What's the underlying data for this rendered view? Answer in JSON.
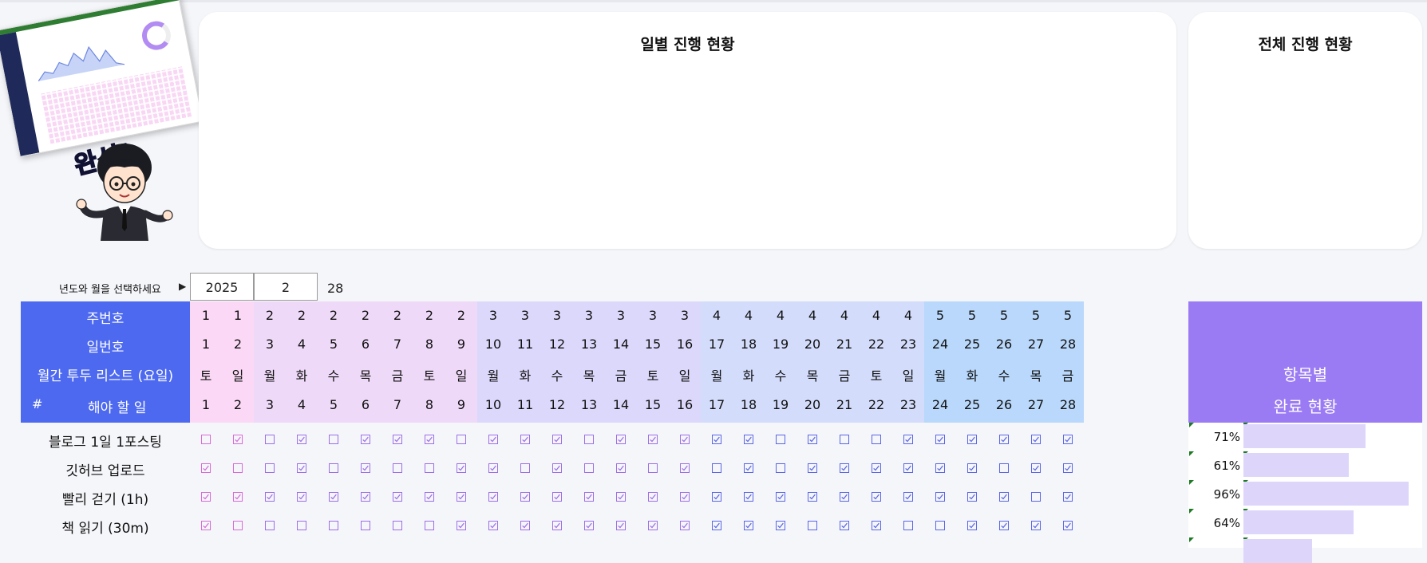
{
  "panels": {
    "daily_title": "일별 진행 현황",
    "overall_title": "전체 진행 현황"
  },
  "selector": {
    "label": "년도와 월을 선택하세요",
    "year": "2025",
    "month": "2",
    "days": "28"
  },
  "header_labels": {
    "week": "주번호",
    "day": "일번호",
    "weekday": "월간 투두 리스트 (요일)",
    "hash": "#",
    "todo": "해야 할 일"
  },
  "days": {
    "week": [
      1,
      1,
      2,
      2,
      2,
      2,
      2,
      2,
      2,
      3,
      3,
      3,
      3,
      3,
      3,
      3,
      4,
      4,
      4,
      4,
      4,
      4,
      4,
      5,
      5,
      5,
      5,
      5
    ],
    "day": [
      1,
      2,
      3,
      4,
      5,
      6,
      7,
      8,
      9,
      10,
      11,
      12,
      13,
      14,
      15,
      16,
      17,
      18,
      19,
      20,
      21,
      22,
      23,
      24,
      25,
      26,
      27,
      28
    ],
    "weekday": [
      "토",
      "일",
      "월",
      "화",
      "수",
      "목",
      "금",
      "토",
      "일",
      "월",
      "화",
      "수",
      "목",
      "금",
      "토",
      "일",
      "월",
      "화",
      "수",
      "목",
      "금",
      "토",
      "일",
      "월",
      "화",
      "수",
      "목",
      "금"
    ],
    "num": [
      1,
      2,
      3,
      4,
      5,
      6,
      7,
      8,
      9,
      10,
      11,
      12,
      13,
      14,
      15,
      16,
      17,
      18,
      19,
      20,
      21,
      22,
      23,
      24,
      25,
      26,
      27,
      28
    ]
  },
  "summary": {
    "line1": "항목별",
    "line2": "완료 현황"
  },
  "tasks": [
    {
      "name": "블로그 1일 1포스팅",
      "pct": "71%",
      "ratio": 0.71,
      "checks": [
        0,
        1,
        0,
        1,
        0,
        1,
        1,
        1,
        0,
        1,
        1,
        1,
        0,
        1,
        1,
        1,
        1,
        1,
        0,
        1,
        0,
        0,
        1,
        1,
        1,
        1,
        1,
        1
      ]
    },
    {
      "name": "깃허브 업로드",
      "pct": "61%",
      "ratio": 0.61,
      "checks": [
        1,
        0,
        0,
        1,
        0,
        1,
        0,
        0,
        1,
        1,
        0,
        1,
        0,
        1,
        0,
        1,
        0,
        1,
        0,
        1,
        1,
        1,
        1,
        1,
        1,
        0,
        1,
        1
      ]
    },
    {
      "name": "빨리 걷기 (1h)",
      "pct": "96%",
      "ratio": 0.96,
      "checks": [
        1,
        1,
        1,
        1,
        1,
        1,
        1,
        1,
        1,
        1,
        1,
        1,
        1,
        1,
        1,
        1,
        1,
        1,
        1,
        1,
        1,
        1,
        1,
        1,
        1,
        1,
        0,
        1
      ]
    },
    {
      "name": "책 읽기 (30m)",
      "pct": "64%",
      "ratio": 0.64,
      "checks": [
        1,
        0,
        0,
        0,
        0,
        0,
        0,
        0,
        1,
        1,
        1,
        1,
        1,
        1,
        1,
        1,
        1,
        1,
        1,
        0,
        1,
        1,
        0,
        0,
        1,
        1,
        1,
        1
      ]
    },
    {
      "name": "",
      "pct": "",
      "ratio": 0.4,
      "checks": []
    }
  ],
  "colors": {
    "header_blue": "#4d69f0",
    "summary_purple": "#9a7bf4",
    "band_week1": "#fbd9f6",
    "band_week2": "#efd9f8",
    "band_week3": "#dcd8fb",
    "band_week4": "#d3dcfb",
    "band_week5": "#b9d8fb",
    "check_pink": "#d86ad8",
    "check_violet": "#9d6ee8",
    "check_blue": "#5a66e6",
    "bar_fill": "#ded5fb"
  }
}
